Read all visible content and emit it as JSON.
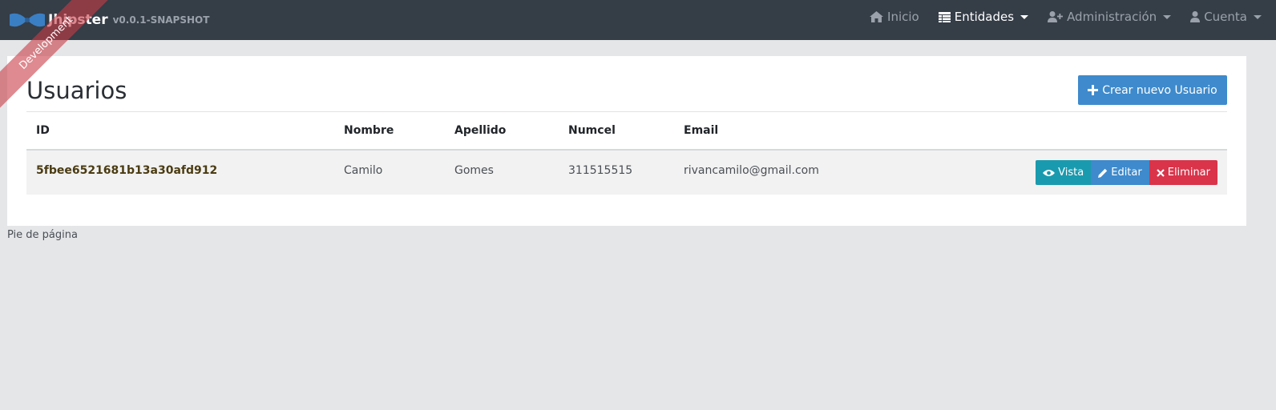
{
  "navbar": {
    "brand_title": "Jhipster",
    "brand_version": "v0.0.1-SNAPSHOT",
    "items": [
      {
        "label": "Inicio",
        "icon": "home-icon"
      },
      {
        "label": "Entidades",
        "icon": "table-icon"
      },
      {
        "label": "Administración",
        "icon": "user-plus-icon"
      },
      {
        "label": "Cuenta",
        "icon": "user-icon"
      }
    ]
  },
  "ribbon": "Development",
  "page": {
    "title": "Usuarios",
    "create_button": "Crear nuevo Usuario"
  },
  "table": {
    "headers": [
      "ID",
      "Nombre",
      "Apellido",
      "Numcel",
      "Email"
    ],
    "rows": [
      {
        "id": "5fbee6521681b13a30afd912",
        "nombre": "Camilo",
        "apellido": "Gomes",
        "numcel": "311515515",
        "email": "rivancamilo@gmail.com",
        "actions": {
          "view": "Vista",
          "edit": "Editar",
          "delete": "Eliminar"
        }
      }
    ]
  },
  "footer": "Pie de página",
  "colors": {
    "navbar": "#353d47",
    "primary": "#3e8acc",
    "info": "#1a9aae",
    "danger": "#d9344a",
    "ribbon": "#c83c46"
  }
}
